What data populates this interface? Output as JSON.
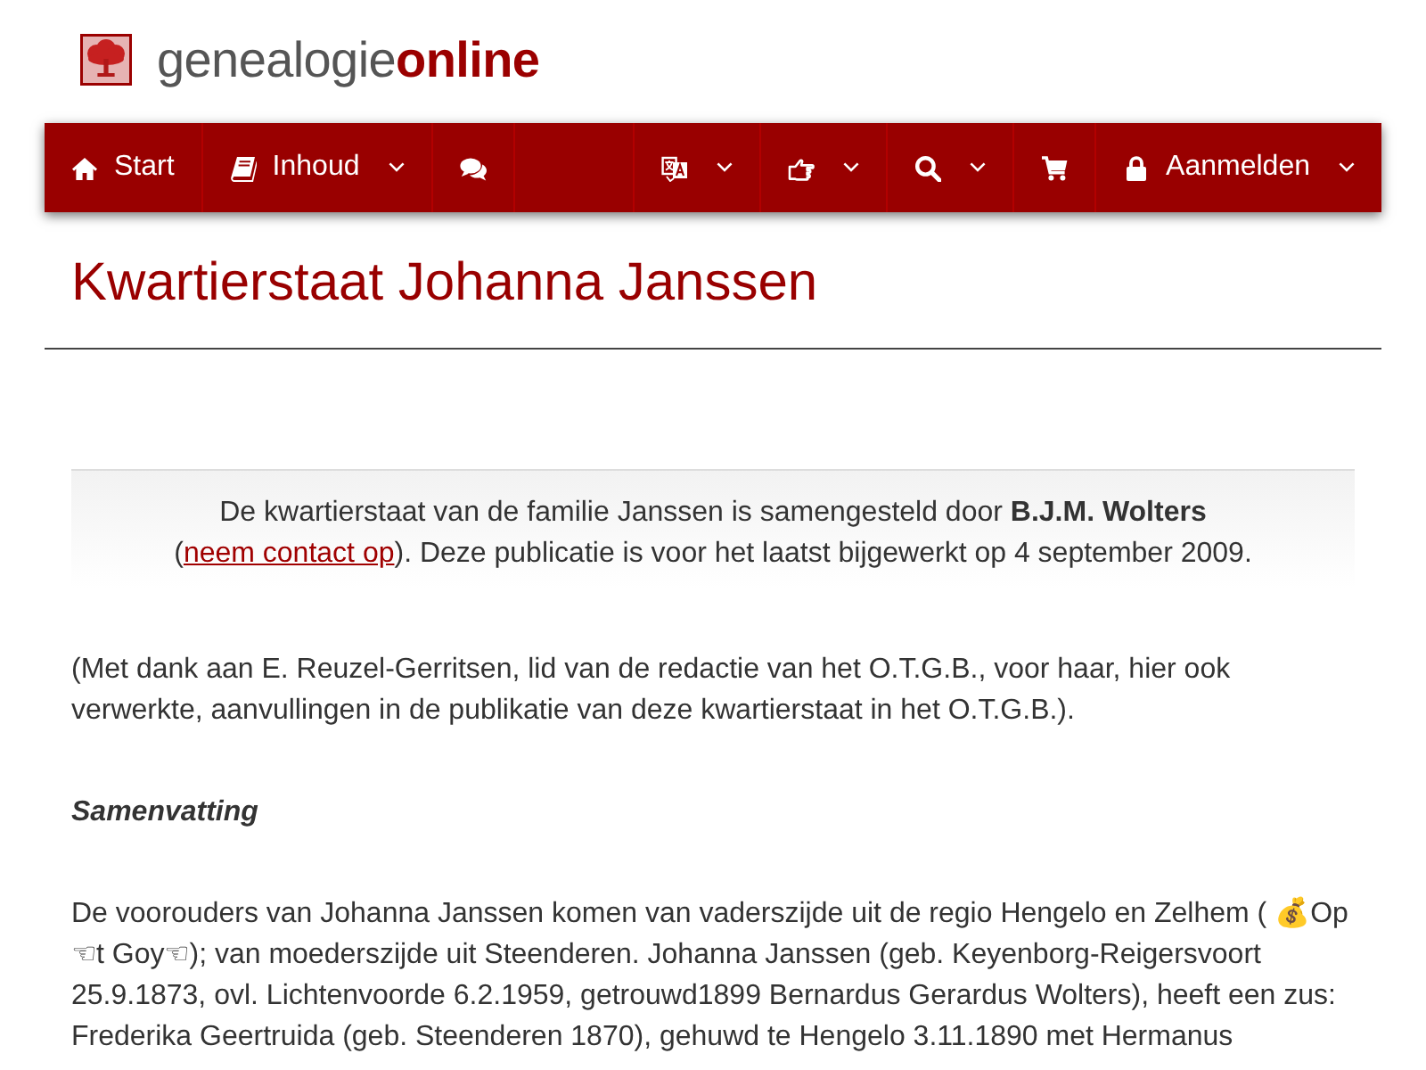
{
  "brand": {
    "text_plain": "genealogie",
    "text_bold": "online"
  },
  "nav": {
    "left_items": [
      {
        "label": "Start",
        "dropdown": false
      },
      {
        "label": "Inhoud",
        "dropdown": true
      },
      {
        "dropdown": false
      }
    ],
    "right_items": [
      {
        "dropdown": true
      },
      {
        "dropdown": true
      },
      {
        "dropdown": true
      },
      {
        "dropdown": false
      },
      {
        "label": "Aanmelden",
        "dropdown": true
      }
    ]
  },
  "page_title": "Kwartierstaat Johanna Janssen",
  "notice": {
    "before": "De kwartierstaat van de familie Janssen is samengesteld door **B.J.M. Wolters** (",
    "link": "neem contact op",
    "after": "). Deze publicatie is voor het laatst bijgewerkt op 4 september 2009."
  },
  "acknowledgement": "(Met dank aan E. Reuzel-Gerritsen, lid van de redactie van het O.T.G.B., voor haar, hier ook verwerkte, aanvullingen in de publikatie van deze kwartierstaat in het O.T.G.B.).",
  "summary_heading": "Samenvatting",
  "summary": "De voorouders van Johanna Janssen komen van vaderszijde uit de regio Hengelo en Zelhem ( 💰Op ☜t Goy☜); van moederszijde uit Steenderen. Johanna Janssen (geb. Keyenborg-Reigersvoort 25.9.1873, ovl. Lichtenvoorde 6.2.1959, getrouwd1899 Bernardus Gerardus Wolters), heeft een zus: Frederika Geertruida (geb. Steenderen 1870), gehuwd te Hengelo 3.11.1890 met Hermanus"
}
